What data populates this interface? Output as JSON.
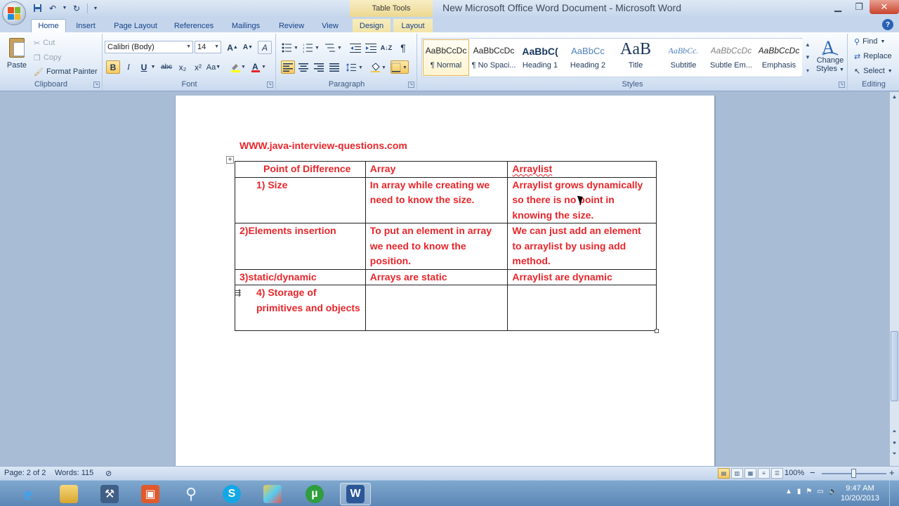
{
  "window": {
    "title": "New Microsoft Office Word Document - Microsoft Word",
    "context_tab_group": "Table Tools",
    "minimize": "▁",
    "restore": "❐",
    "close": "✕"
  },
  "tabs": [
    {
      "label": "Home"
    },
    {
      "label": "Insert"
    },
    {
      "label": "Page Layout"
    },
    {
      "label": "References"
    },
    {
      "label": "Mailings"
    },
    {
      "label": "Review"
    },
    {
      "label": "View"
    },
    {
      "label": "Design"
    },
    {
      "label": "Layout"
    }
  ],
  "help": "?",
  "clipboard": {
    "paste": "Paste",
    "cut": "Cut",
    "copy": "Copy",
    "format_painter": "Format Painter",
    "group_label": "Clipboard"
  },
  "font": {
    "family": "Calibri (Body)",
    "size": "14",
    "group_label": "Font",
    "bold": "B",
    "italic": "I",
    "underline": "U",
    "strikethrough": "abc",
    "subscript": "x₂",
    "superscript": "x²",
    "change_case": "Aa",
    "grow": "A",
    "shrink": "A",
    "clear": "A"
  },
  "paragraph": {
    "group_label": "Paragraph",
    "pilcrow": "¶"
  },
  "styles": {
    "group_label": "Styles",
    "items": [
      {
        "sample": "AaBbCcDc",
        "name": "¶ Normal"
      },
      {
        "sample": "AaBbCcDc",
        "name": "¶ No Spaci..."
      },
      {
        "sample": "AaBbC(",
        "name": "Heading 1"
      },
      {
        "sample": "AaBbCc",
        "name": "Heading 2"
      },
      {
        "sample": "AaB",
        "name": "Title"
      },
      {
        "sample": "AaBbCc.",
        "name": "Subtitle"
      },
      {
        "sample": "AaBbCcDc",
        "name": "Subtle Em..."
      },
      {
        "sample": "AaBbCcDc",
        "name": "Emphasis"
      }
    ],
    "change_styles_line1": "Change",
    "change_styles_line2": "Styles"
  },
  "editing": {
    "group_label": "Editing",
    "find": "Find",
    "replace": "Replace",
    "select": "Select"
  },
  "document": {
    "link": "WWW.java-interview-questions.com",
    "table": {
      "header": [
        "Point of Difference",
        "Array",
        "Arraylist"
      ],
      "rows": [
        [
          "1)  Size",
          "In array while creating we need to know the size.",
          "Arraylist grows dynamically so there is no point in knowing the size."
        ],
        [
          "2)Elements insertion",
          "To put an element in array we need to know the position.",
          "We can just add an element to arraylist by using add method."
        ],
        [
          "3)static/dynamic",
          "Arrays are static",
          "Arraylist are dynamic"
        ],
        [
          "4)  Storage of primitives and objects",
          "",
          ""
        ]
      ]
    }
  },
  "status": {
    "page": "Page: 2 of 2",
    "words": "Words: 115",
    "zoom": "100%",
    "zoom_minus": "−",
    "zoom_plus": "+"
  },
  "taskbar": {
    "time": "9:47 AM",
    "date": "10/20/2013"
  },
  "colors": {
    "doc_text": "#e8262b",
    "ribbon_bg": "#dde8f6",
    "taskbar": "#5c86b5"
  }
}
